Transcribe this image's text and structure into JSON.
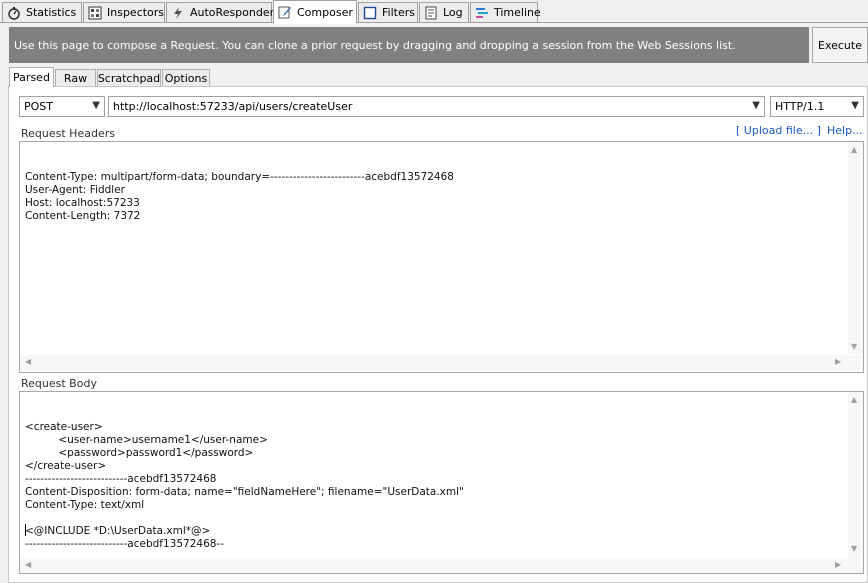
{
  "top_tabs": [
    {
      "label": "Statistics",
      "icon": "stopwatch-icon"
    },
    {
      "label": "Inspectors",
      "icon": "inspectors-icon"
    },
    {
      "label": "AutoResponder",
      "icon": "lightning-icon"
    },
    {
      "label": "Composer",
      "icon": "pencil-icon"
    },
    {
      "label": "Filters",
      "icon": "filter-checkbox-icon"
    },
    {
      "label": "Log",
      "icon": "log-icon"
    },
    {
      "label": "Timeline",
      "icon": "timeline-icon"
    }
  ],
  "banner": {
    "text": "Use this page to compose a Request. You can clone a prior request by dragging and dropping a session from the Web Sessions list.",
    "execute_label": "Execute"
  },
  "sub_tabs": [
    "Parsed",
    "Raw",
    "Scratchpad",
    "Options"
  ],
  "request_line": {
    "method": "POST",
    "url": "http://localhost:57233/api/users/createUser",
    "version": "HTTP/1.1"
  },
  "headers_section": {
    "label": "Request Headers",
    "upload_link": "[ Upload file... ]",
    "help_link": "Help...",
    "content": "Content-Type: multipart/form-data; boundary=-------------------------acebdf13572468\nUser-Agent: Fiddler\nHost: localhost:57233\nContent-Length: 7372"
  },
  "body_section": {
    "label": "Request Body",
    "content": "<create-user>\n          <user-name>username1</user-name>\n          <password>password1</password>\n</create-user>\n---------------------------acebdf13572468\nContent-Disposition: form-data; name=\"fieldNameHere\"; filename=\"UserData.xml\"\nContent-Type: text/xml\n\n<@INCLUDE *D:\\UserData.xml*@>\n---------------------------acebdf13572468--"
  }
}
